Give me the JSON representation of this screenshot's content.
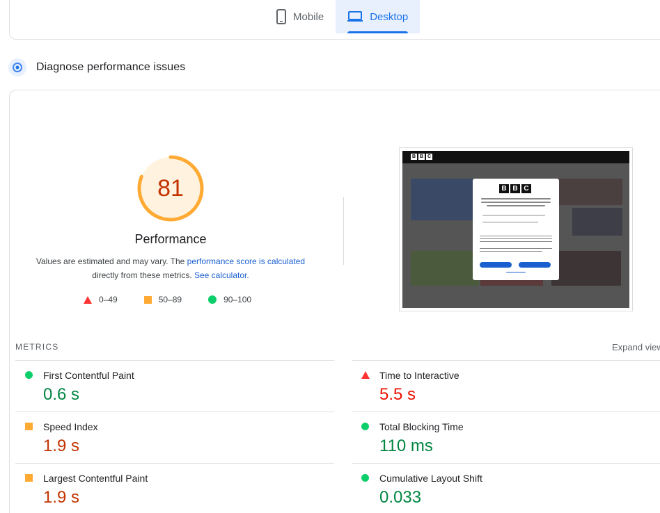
{
  "device_tabs": {
    "mobile_label": "Mobile",
    "desktop_label": "Desktop",
    "active": "desktop"
  },
  "section": {
    "title": "Diagnose performance issues"
  },
  "performance": {
    "score": "81",
    "title": "Performance",
    "desc_part1": "Values are estimated and may vary. The ",
    "desc_link1": "performance score is calculated",
    "desc_part2": "directly from these metrics. ",
    "desc_link2": "See calculator.",
    "score_fraction": 0.81,
    "gauge_color": "#ffaa33"
  },
  "legend": [
    {
      "shape": "triangle",
      "label": "0–49",
      "color": "#ff3333"
    },
    {
      "shape": "square",
      "label": "50–89",
      "color": "#ffaa33"
    },
    {
      "shape": "circle",
      "label": "90–100",
      "color": "#0cce6b"
    }
  ],
  "metrics": {
    "label": "METRICS",
    "expand_label": "Expand view",
    "items": [
      {
        "name": "First Contentful Paint",
        "value": "0.6 s",
        "rating": "good",
        "icon": "circle"
      },
      {
        "name": "Time to Interactive",
        "value": "5.5 s",
        "rating": "bad",
        "icon": "triangle"
      },
      {
        "name": "Speed Index",
        "value": "1.9 s",
        "rating": "average",
        "icon": "square"
      },
      {
        "name": "Total Blocking Time",
        "value": "110 ms",
        "rating": "good",
        "icon": "circle"
      },
      {
        "name": "Largest Contentful Paint",
        "value": "1.9 s",
        "rating": "average",
        "icon": "square"
      },
      {
        "name": "Cumulative Layout Shift",
        "value": "0.033",
        "rating": "good",
        "icon": "circle"
      }
    ]
  },
  "screenshot": {
    "logo_letters": [
      "B",
      "B",
      "C"
    ]
  }
}
